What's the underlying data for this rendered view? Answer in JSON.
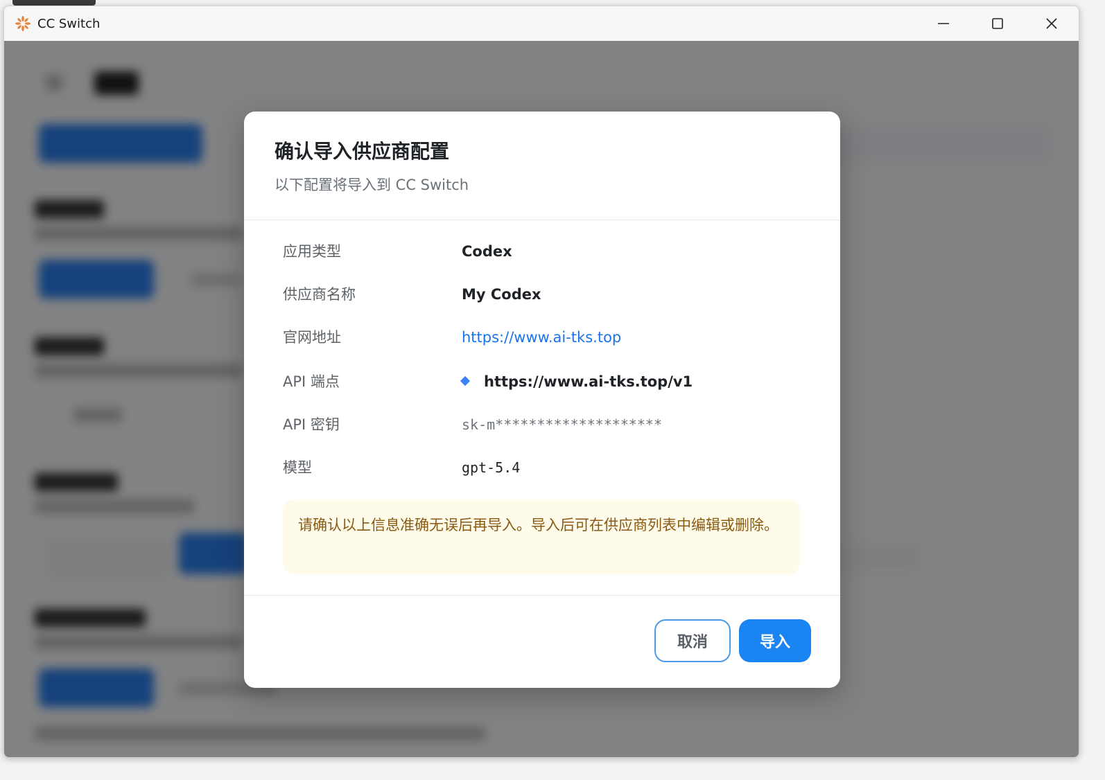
{
  "window": {
    "title": "CC Switch",
    "controls": [
      "minimize-icon",
      "maximize-icon",
      "close-icon"
    ]
  },
  "dialog": {
    "title": "确认导入供应商配置",
    "subtitle": "以下配置将导入到 CC Switch",
    "rows": [
      {
        "label": "应用类型",
        "value": "Codex"
      },
      {
        "label": "供应商名称",
        "value": "My Codex"
      },
      {
        "label": "官网地址",
        "value": "https://www.ai-tks.top"
      },
      {
        "label": "API 端点",
        "value": "https://www.ai-tks.top/v1"
      },
      {
        "label": "API 密钥",
        "value": "sk-m********************"
      },
      {
        "label": "模型",
        "value": "gpt-5.4"
      }
    ],
    "warning": "请确认以上信息准确无误后再导入。导入后可在供应商列表中编辑或删除。",
    "buttons": {
      "cancel": "取消",
      "import": "导入"
    }
  },
  "colors": {
    "accent": "#1a85f2",
    "link": "#1a73e8",
    "warning_bg": "#fefbea",
    "warning_text": "#8a5a12",
    "overlay": "rgba(0,0,0,0.47)"
  }
}
